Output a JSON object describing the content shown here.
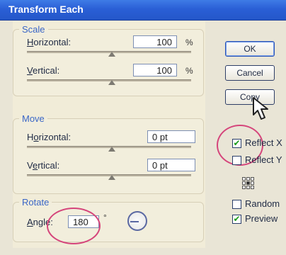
{
  "dialog": {
    "title": "Transform Each"
  },
  "scale": {
    "legend": "Scale",
    "horizontal": {
      "label": "Horizontal:",
      "value": "100",
      "unit": "%"
    },
    "vertical": {
      "label": "Vertical:",
      "value": "100",
      "unit": "%"
    }
  },
  "move": {
    "legend": "Move",
    "horizontal": {
      "label": "Horizontal:",
      "value": "0 pt"
    },
    "vertical": {
      "label": "Vertical:",
      "value": "0 pt"
    }
  },
  "rotate": {
    "legend": "Rotate",
    "angle": {
      "label": "Angle:",
      "value": "180",
      "unit": "°"
    }
  },
  "buttons": {
    "ok": "OK",
    "cancel": "Cancel",
    "copy": "Copy"
  },
  "options": {
    "reflect_x": {
      "label": "Reflect X",
      "checked": true
    },
    "reflect_y": {
      "label": "Reflect Y",
      "checked": false
    },
    "random": {
      "label": "Random",
      "checked": false
    },
    "preview": {
      "label": "Preview",
      "checked": true
    }
  },
  "colors": {
    "title_bar": "#2a5fd6",
    "highlight_circle": "#d5457b",
    "legend_text": "#3a66c6"
  },
  "icons": {
    "reference_point": "grid-3x3-icon",
    "angle_dial": "angle-dial-icon",
    "cursor": "arrow-cursor-icon"
  }
}
